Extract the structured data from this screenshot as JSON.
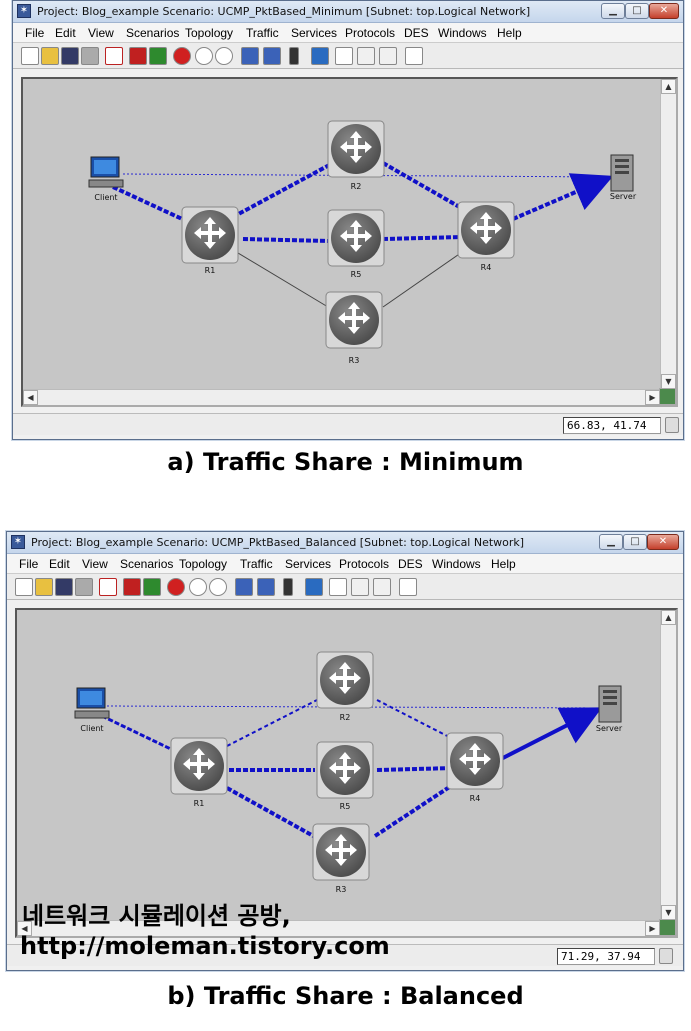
{
  "windows": [
    {
      "title": "Project: Blog_example Scenario: UCMP_PktBased_Minimum  [Subnet: top.Logical Network]",
      "coords": "66.83, 41.74",
      "caption": "a) Traffic Share : Minimum"
    },
    {
      "title": "Project: Blog_example Scenario: UCMP_PktBased_Balanced  [Subnet: top.Logical Network]",
      "coords": "71.29, 37.94",
      "caption": "b) Traffic Share : Balanced"
    }
  ],
  "menu": [
    "File",
    "Edit",
    "View",
    "Scenarios",
    "Topology",
    "Traffic",
    "Services",
    "Protocols",
    "DES",
    "Windows",
    "Help"
  ],
  "window_buttons": {
    "minimize": "▁",
    "maximize": "□",
    "close": "✕"
  },
  "nodes": {
    "client": "Client",
    "server": "Server",
    "r1": "R1",
    "r2": "R2",
    "r3": "R3",
    "r4": "R4",
    "r5": "R5"
  },
  "watermark": {
    "line1": "네트워크 시뮬레이션 공방,",
    "line2": "http://moleman.tistory.com"
  },
  "toolbar_icons": [
    "new-icon",
    "open-icon",
    "save-icon",
    "print-icon",
    "select-icon",
    "stop-icon",
    "run-icon",
    "fail-icon",
    "zoom-in-icon",
    "zoom-out-icon",
    "ace-icon",
    "vne-icon",
    "traffic-light-icon",
    "triangle-icon",
    "link-icon",
    "chart-icon",
    "graph-icon",
    "info-icon"
  ],
  "colors": {
    "flow": "#1010c8",
    "canvas": "#c6c6c6",
    "router": "#6c6c6c"
  }
}
